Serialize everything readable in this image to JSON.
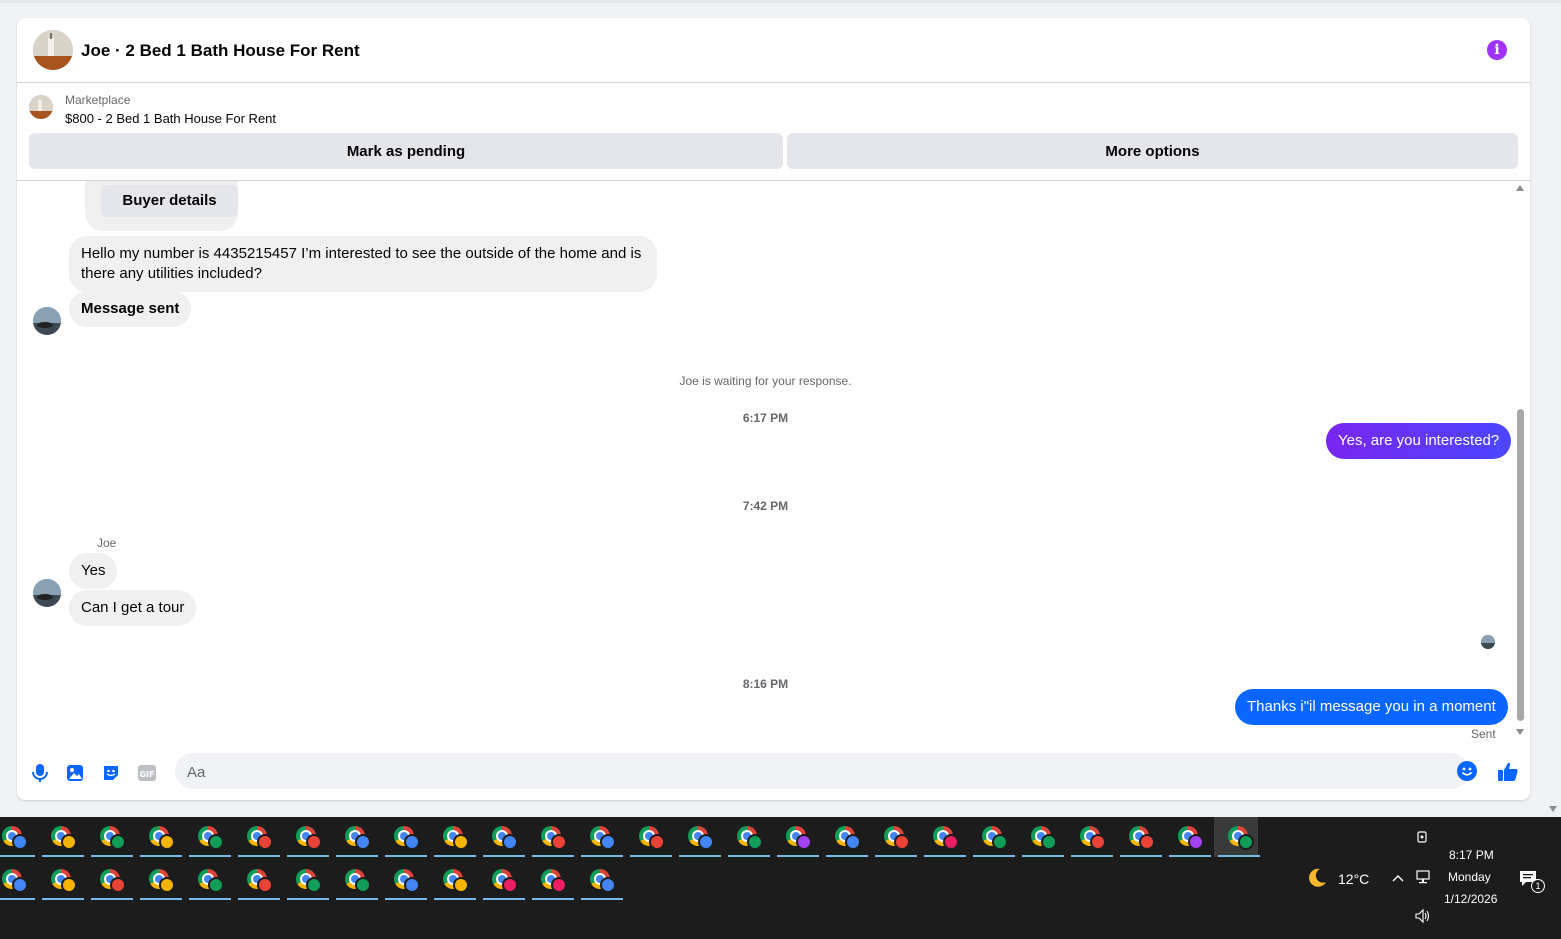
{
  "header": {
    "title": "Joe · 2 Bed 1 Bath House For Rent",
    "info_icon": "info-icon"
  },
  "marketplace": {
    "label": "Marketplace",
    "listing": "$800 - 2 Bed 1 Bath House For Rent",
    "mark_pending": "Mark as pending",
    "more_options": "More options"
  },
  "thread": {
    "buyer_details": "Buyer details",
    "msg_intro": "Hello my number is 4435215457 I’m interested to see the outside of the home and is there any utilities included?",
    "msg_sent": "Message sent",
    "waiting": "Joe is waiting for your response.",
    "time1": "6:17 PM",
    "out1": "Yes, are you interested?",
    "time2": "7:42 PM",
    "sender": "Joe",
    "in_yes": "Yes",
    "in_tour": "Can I get a tour",
    "time3": "8:16 PM",
    "out2": "Thanks i\"il message you in a moment",
    "sent_status": "Sent"
  },
  "composer": {
    "placeholder": "Aa"
  },
  "taskbar": {
    "weather_temp": "12°C",
    "time": "8:17 PM",
    "day": "Monday",
    "date": "1/12/2026",
    "notification_count": "1",
    "row1_badges": [
      "#4285f4",
      "#f4b400",
      "#0f9d58",
      "#f4b400",
      "#0f9d58",
      "#ea4335",
      "#ea4335",
      "#4285f4",
      "#4285f4",
      "#f4b400",
      "#4285f4",
      "#ea4335",
      "#4285f4",
      "#ea4335",
      "#4285f4",
      "#0f9d58",
      "#a142f4",
      "#4285f4",
      "#ea4335",
      "#e91e63",
      "#0f9d58",
      "#0f9d58",
      "#ea4335",
      "#ea4335",
      "#a142f4",
      "#0f9d58"
    ],
    "row2_badges": [
      "#4285f4",
      "#f4b400",
      "#ea4335",
      "#f4b400",
      "#0f9d58",
      "#ea4335",
      "#0f9d58",
      "#0f9d58",
      "#4285f4",
      "#f4b400",
      "#e91e63",
      "#e91e63",
      "#4285f4"
    ]
  },
  "colors": {
    "accent_purple": "#a033ff",
    "bubble_out_purple": "#6a2fff",
    "bubble_out_blue": "#0a66ff",
    "messenger_blue": "#0866ff"
  }
}
